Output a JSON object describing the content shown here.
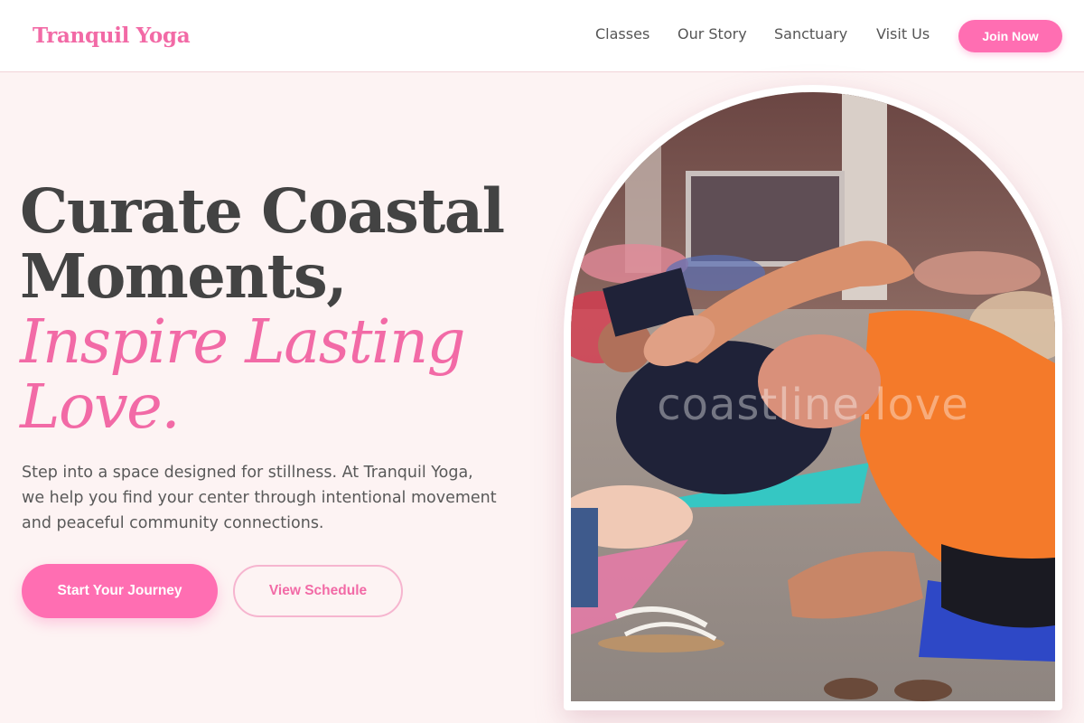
{
  "brand": {
    "name": "Tranquil Yoga",
    "accent": "#f26aa6",
    "button": "#ff6eb2"
  },
  "nav": {
    "items": [
      {
        "label": "Classes"
      },
      {
        "label": "Our Story"
      },
      {
        "label": "Sanctuary"
      },
      {
        "label": "Visit Us"
      }
    ],
    "cta_label": "Join Now"
  },
  "hero": {
    "headline_line1": "Curate Coastal",
    "headline_line2": "Moments,",
    "accent_line1": "Inspire Lasting",
    "accent_line2": "Love.",
    "subtext": "Step into a space designed for stillness. At Tranquil Yoga, we help you find your center through intentional movement and peaceful community connections.",
    "primary_label": "Start Your Journey",
    "secondary_label": "View Schedule"
  },
  "image": {
    "description_icon": "yoga-class-photo",
    "watermark": "coastline.love"
  }
}
